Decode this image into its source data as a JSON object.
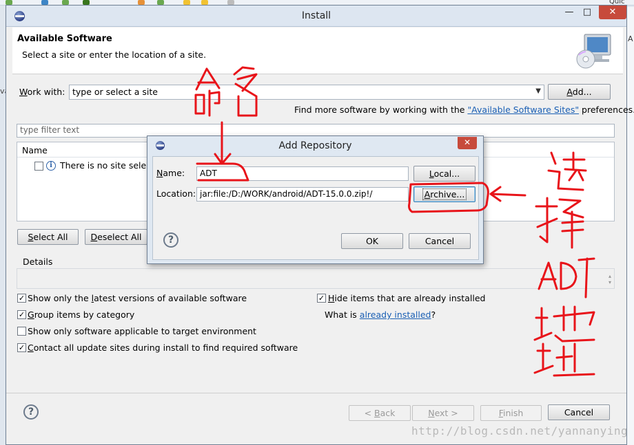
{
  "ide": {
    "right_label_top": "Quic",
    "right_letter": "A",
    "left_fragment": "va"
  },
  "window": {
    "title": "Install",
    "minimize": "—",
    "maximize": "□",
    "close": "✕"
  },
  "header": {
    "title": "Available Software",
    "subtitle": "Select a site or enter the location of a site."
  },
  "work_with": {
    "label_underlined": "W",
    "label_rest": "ork with:",
    "placeholder": "type or select a site",
    "add_label_underlined": "A",
    "add_label_rest": "dd..."
  },
  "find_more": {
    "prefix": "Find more software by working with the ",
    "link": "\"Available Software Sites\"",
    "suffix": " preferences."
  },
  "filter": {
    "placeholder": "type filter text"
  },
  "table": {
    "column_name": "Name",
    "empty_message": "There is no site select"
  },
  "buttons": {
    "select_all_u": "S",
    "select_all_rest": "elect All",
    "deselect_all_u": "D",
    "deselect_all_rest": "eselect All"
  },
  "details": {
    "label": "Details"
  },
  "options": [
    {
      "checked": true,
      "pre": "Show only the ",
      "u": "l",
      "post": "atest versions of available software"
    },
    {
      "checked": true,
      "pre": "",
      "u": "G",
      "post": "roup items by category"
    },
    {
      "checked": false,
      "pre": "Show only software applicable to target environment",
      "u": "",
      "post": ""
    },
    {
      "checked": true,
      "pre": "",
      "u": "C",
      "post": "ontact all update sites during install to find required software"
    }
  ],
  "hide_installed": {
    "checked": true,
    "u": "H",
    "rest": "ide items that are already installed"
  },
  "what_is": {
    "prefix": "What is ",
    "link": "already installed",
    "suffix": "?"
  },
  "footer": {
    "back": "< Back",
    "back_u": "B",
    "next": "Next >",
    "next_u": "N",
    "finish": "Finish",
    "finish_u": "F",
    "cancel": "Cancel"
  },
  "dialog": {
    "title": "Add Repository",
    "close": "✕",
    "name_label_u": "N",
    "name_label_rest": "ame:",
    "name_value": "ADT",
    "location_label": "Location:",
    "location_value": "jar:file:/D:/WORK/android/ADT-15.0.0.zip!/",
    "local_u": "L",
    "local_rest": "ocal...",
    "archive_u": "A",
    "archive_rest": "rchive...",
    "ok": "OK",
    "cancel": "Cancel"
  },
  "annotations": {
    "colors": {
      "ink": "#e8141a"
    }
  },
  "watermark": "http://blog.csdn.net/yannanying"
}
